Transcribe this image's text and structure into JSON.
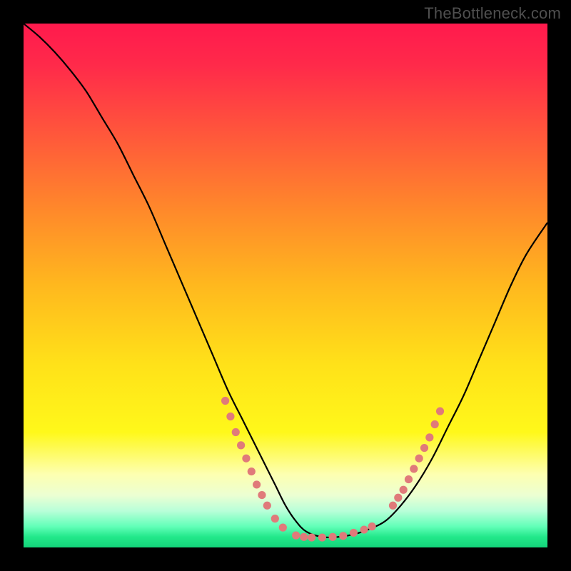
{
  "watermark": "TheBottleneck.com",
  "chart_data": {
    "type": "line",
    "title": "",
    "xlabel": "",
    "ylabel": "",
    "xlim": [
      0,
      100
    ],
    "ylim": [
      0,
      100
    ],
    "grid": false,
    "series": [
      {
        "name": "curve",
        "stroke": "#000000",
        "stroke_width": 2.2,
        "x": [
          0,
          3,
          6,
          9,
          12,
          15,
          18,
          21,
          24,
          27,
          30,
          33,
          36,
          39,
          42,
          45,
          48,
          50,
          52,
          54,
          57,
          60,
          63,
          66,
          69,
          72,
          75,
          78,
          81,
          84,
          87,
          90,
          93,
          96,
          100
        ],
        "y": [
          100,
          97.5,
          94.5,
          91,
          87,
          82,
          77,
          71,
          65,
          58,
          51,
          44,
          37,
          30,
          24,
          18,
          12,
          8,
          5,
          3,
          2,
          2,
          2.5,
          3.5,
          5,
          8,
          12,
          17,
          23,
          29,
          36,
          43,
          50,
          56,
          62
        ]
      }
    ],
    "dot_groups": [
      {
        "name": "left-dotted-segment",
        "fill": "#e07a7a",
        "r": 5.6,
        "points": [
          {
            "x": 38.5,
            "y": 28
          },
          {
            "x": 39.5,
            "y": 25
          },
          {
            "x": 40.5,
            "y": 22
          },
          {
            "x": 41.5,
            "y": 19.5
          },
          {
            "x": 42.5,
            "y": 17
          },
          {
            "x": 43.5,
            "y": 14.5
          },
          {
            "x": 44.5,
            "y": 12
          },
          {
            "x": 45.5,
            "y": 10
          },
          {
            "x": 46.5,
            "y": 8
          },
          {
            "x": 48.0,
            "y": 5.5
          },
          {
            "x": 49.5,
            "y": 3.8
          }
        ]
      },
      {
        "name": "bottom-dotted-segment",
        "fill": "#e07a7a",
        "r": 5.6,
        "points": [
          {
            "x": 52,
            "y": 2.3
          },
          {
            "x": 53.5,
            "y": 2.0
          },
          {
            "x": 55,
            "y": 1.9
          },
          {
            "x": 57,
            "y": 1.9
          },
          {
            "x": 59,
            "y": 2.0
          },
          {
            "x": 61,
            "y": 2.2
          },
          {
            "x": 63,
            "y": 2.8
          },
          {
            "x": 65,
            "y": 3.4
          },
          {
            "x": 66.5,
            "y": 4.0
          }
        ]
      },
      {
        "name": "right-dotted-segment",
        "fill": "#e07a7a",
        "r": 5.6,
        "points": [
          {
            "x": 70.5,
            "y": 8
          },
          {
            "x": 71.5,
            "y": 9.5
          },
          {
            "x": 72.5,
            "y": 11
          },
          {
            "x": 73.5,
            "y": 13
          },
          {
            "x": 74.5,
            "y": 15
          },
          {
            "x": 75.5,
            "y": 17
          },
          {
            "x": 76.5,
            "y": 19
          },
          {
            "x": 77.5,
            "y": 21
          },
          {
            "x": 78.5,
            "y": 23.5
          },
          {
            "x": 79.5,
            "y": 26
          }
        ]
      }
    ],
    "background_gradient": {
      "type": "vertical",
      "stops": [
        {
          "pos": 0.0,
          "color": "#ff1a4d"
        },
        {
          "pos": 0.5,
          "color": "#ffb81e"
        },
        {
          "pos": 0.78,
          "color": "#fff81a"
        },
        {
          "pos": 0.92,
          "color": "#d8ffd2"
        },
        {
          "pos": 1.0,
          "color": "#14d47a"
        }
      ]
    }
  }
}
